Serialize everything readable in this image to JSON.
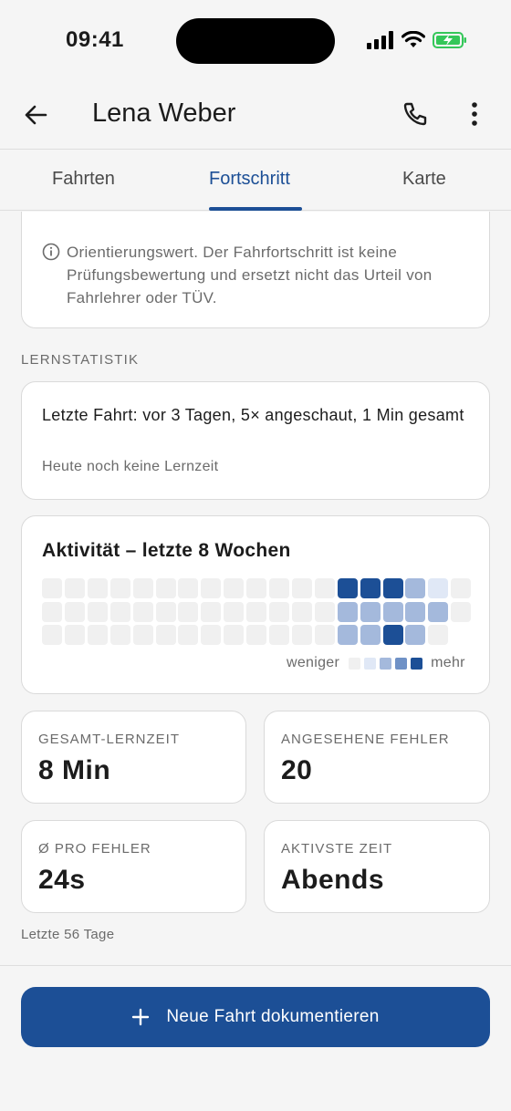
{
  "status": {
    "time": "09:41"
  },
  "header": {
    "title": "Lena Weber"
  },
  "tabs": [
    {
      "label": "Fahrten",
      "active": false
    },
    {
      "label": "Fortschritt",
      "active": true
    },
    {
      "label": "Karte",
      "active": false
    }
  ],
  "info": {
    "text": "Orientierungswert. Der Fahrfortschritt ist keine Prüfungsbewertung und ersetzt nicht das Urteil von Fahrlehrer oder TÜV."
  },
  "section_label": "LERNSTATISTIK",
  "last": {
    "line1": "Letzte Fahrt: vor 3 Tagen, 5× angeschaut, 1 Min gesamt",
    "line2": "Heute noch keine Lernzeit"
  },
  "activity": {
    "title": "Aktivität – letzte 8 Wochen",
    "legend_less": "weniger",
    "legend_more": "mehr",
    "levels": [
      "#f0f0f0",
      "#e0e8f6",
      "#a4b9dc",
      "#6f91c6",
      "#1c4f96"
    ],
    "grid": [
      [
        0,
        0,
        0,
        0,
        0,
        0,
        0,
        0,
        0,
        0,
        0,
        0,
        0,
        4,
        4,
        4,
        2,
        1,
        0
      ],
      [
        0,
        0,
        0,
        0,
        0,
        0,
        0,
        0,
        0,
        0,
        0,
        0,
        0,
        2,
        2,
        2,
        2,
        2,
        0
      ],
      [
        0,
        0,
        0,
        0,
        0,
        0,
        0,
        0,
        0,
        0,
        0,
        0,
        0,
        2,
        2,
        4,
        2,
        0,
        -1
      ]
    ]
  },
  "stats": [
    {
      "label": "GESAMT-LERNZEIT",
      "value": "8 Min"
    },
    {
      "label": "ANGESEHENE FEHLER",
      "value": "20"
    },
    {
      "label": "Ø PRO FEHLER",
      "value": "24s"
    },
    {
      "label": "AKTIVSTE ZEIT",
      "value": "Abends"
    }
  ],
  "footnote": "Letzte 56 Tage",
  "primary_action": {
    "label": "Neue Fahrt dokumentieren"
  },
  "colors": {
    "accent": "#1c4f96",
    "battery": "#34c759"
  }
}
